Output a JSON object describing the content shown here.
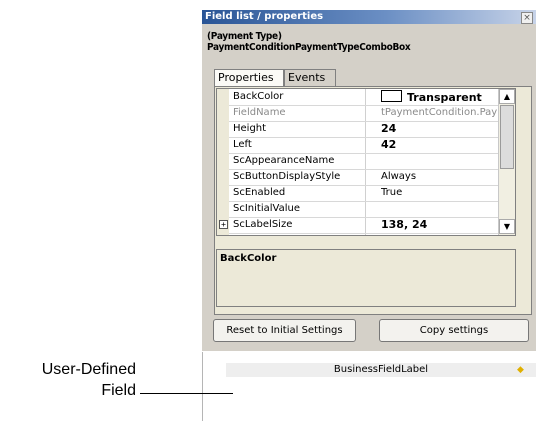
{
  "window": {
    "title": "Field list / properties",
    "close_glyph": "×",
    "field_caption": "(Payment Type)",
    "field_name": "PaymentConditionPaymentTypeComboBox"
  },
  "tabs": [
    {
      "label": "Properties",
      "active": true
    },
    {
      "label": "Events",
      "active": false
    }
  ],
  "properties": [
    {
      "name": "BackColor",
      "value": "Transparent"
    },
    {
      "name": "FieldName",
      "value": "tPaymentCondition.PaymentC"
    },
    {
      "name": "Height",
      "value": "24"
    },
    {
      "name": "Left",
      "value": "42"
    },
    {
      "name": "ScAppearanceName",
      "value": ""
    },
    {
      "name": "ScButtonDisplayStyle",
      "value": "Always"
    },
    {
      "name": "ScEnabled",
      "value": "True"
    },
    {
      "name": "ScInitialValue",
      "value": ""
    },
    {
      "name": "ScLabelSize",
      "value": "138, 24"
    }
  ],
  "expander_glyph": "+",
  "scroll": {
    "up": "▲",
    "down": "▼"
  },
  "description": {
    "title": "BackColor"
  },
  "buttons": {
    "reset": "Reset to Initial Settings",
    "copy": "Copy settings"
  },
  "field_list_item": "BusinessFieldLabel",
  "callout": {
    "line1": "User-Defined",
    "line2": "Field"
  },
  "colors": {
    "titlebar": "#2a5596",
    "panel": "#d4d0c8",
    "marker": "#e0b000"
  }
}
